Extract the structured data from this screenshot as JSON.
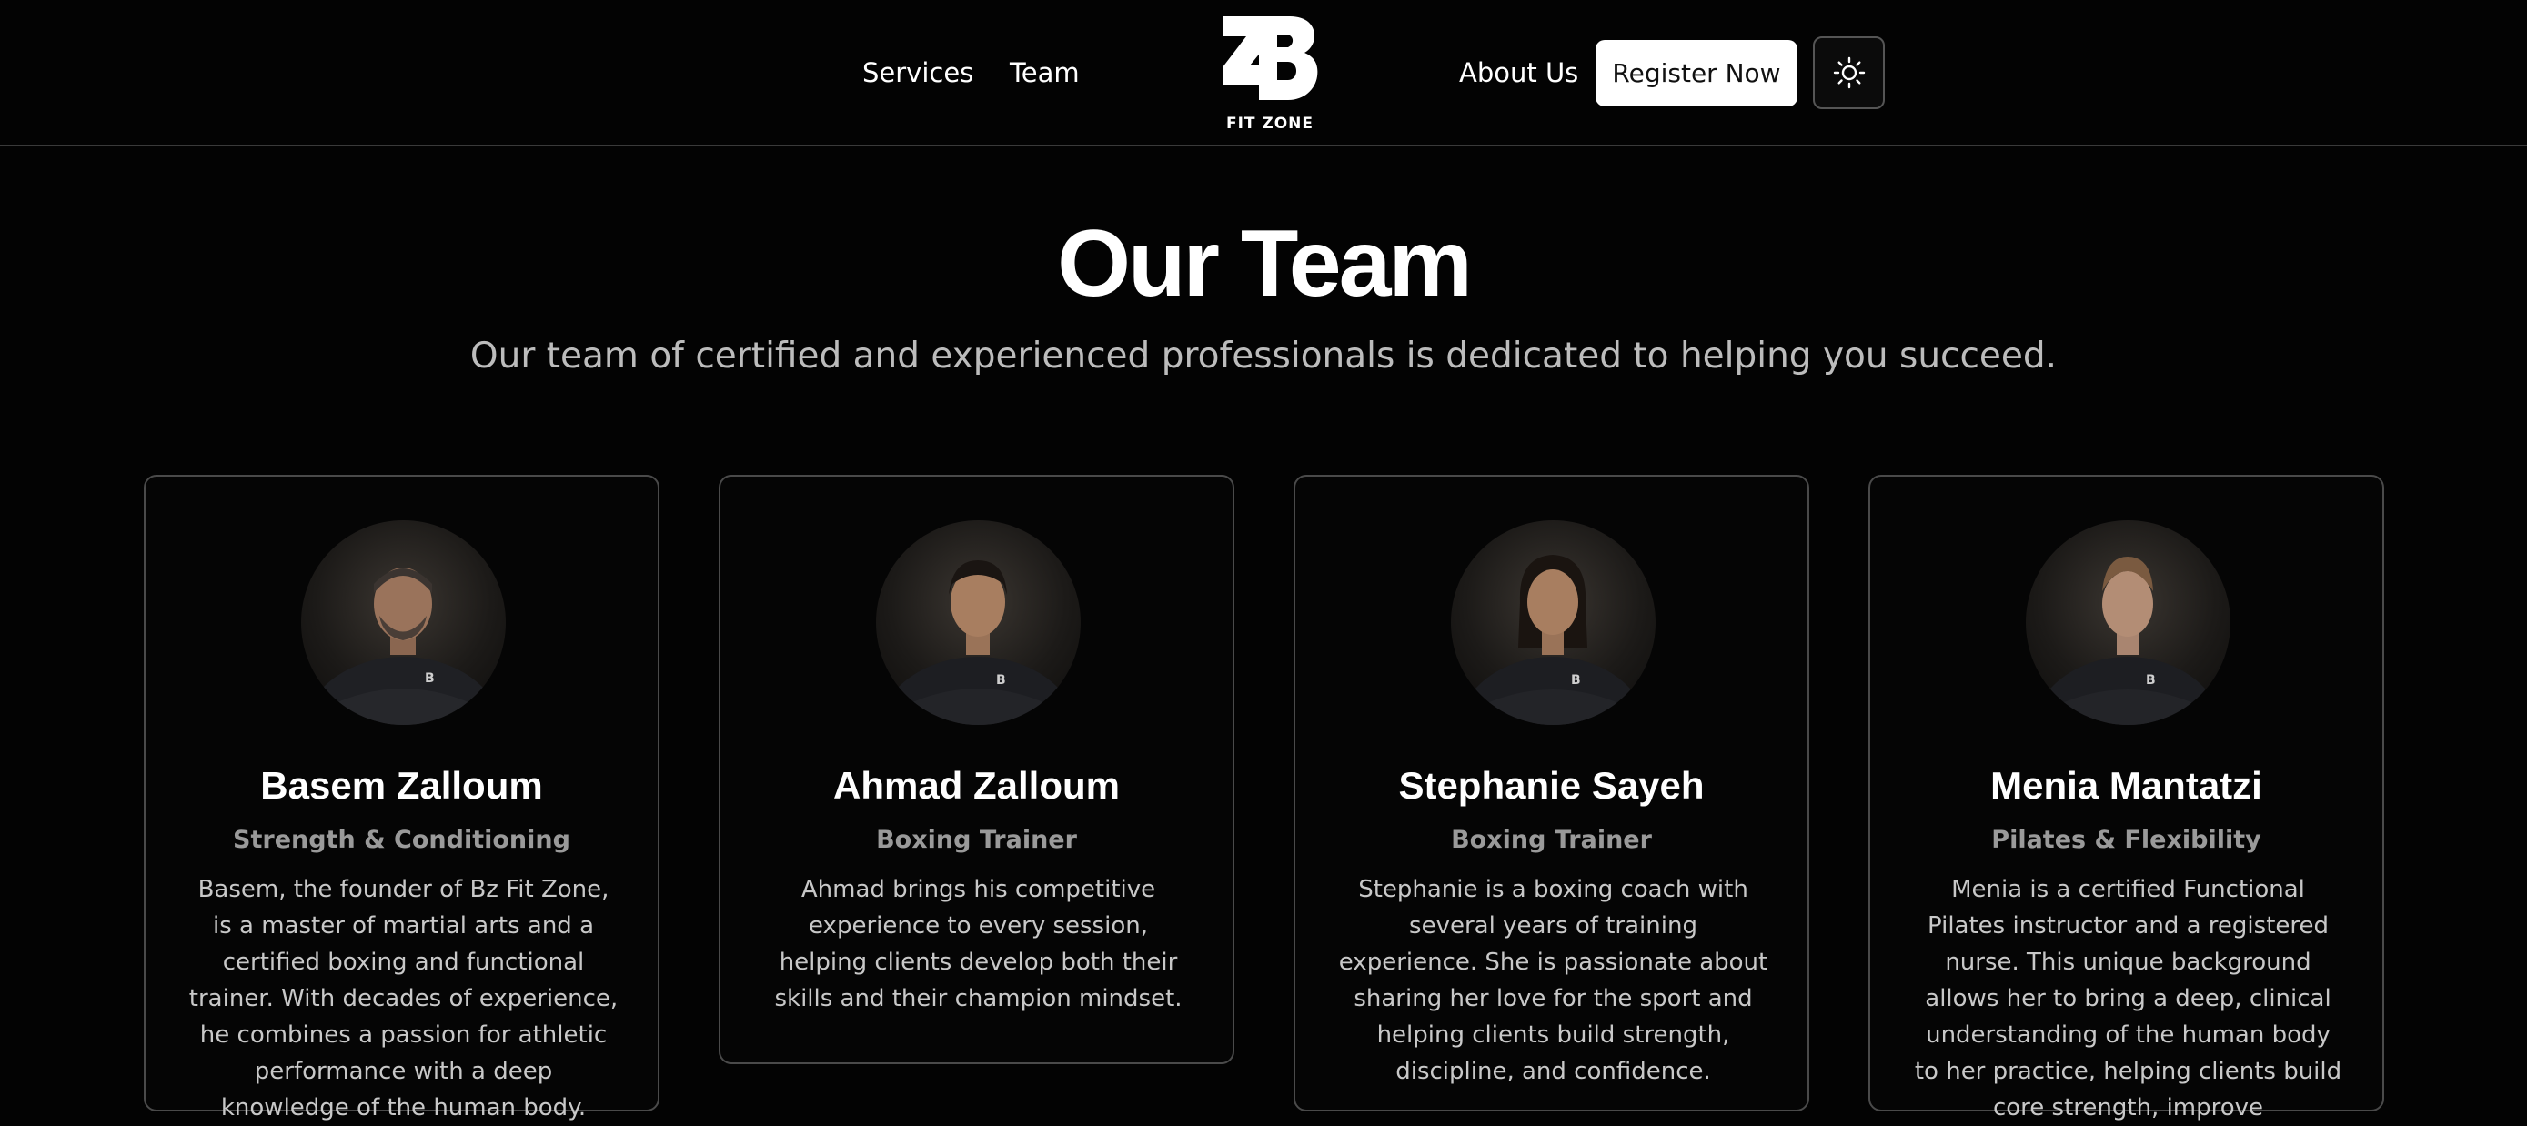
{
  "nav": {
    "services": "Services",
    "team": "Team",
    "about": "About Us",
    "register": "Register Now",
    "logo_text": "FIT ZONE",
    "theme_icon": "sun-icon"
  },
  "hero": {
    "title": "Our Team",
    "subtitle": "Our team of certified and experienced professionals is dedicated to helping you succeed."
  },
  "team": [
    {
      "name": "Basem Zalloum",
      "role": "Strength & Conditioning",
      "bio": "Basem, the founder of Bz Fit Zone, is a master of martial arts and a certified boxing and functional trainer. With decades of experience, he combines a passion for athletic performance with a deep knowledge of the human body."
    },
    {
      "name": "Ahmad Zalloum",
      "role": "Boxing Trainer",
      "bio": "Ahmad brings his competitive experience to every session, helping clients develop both their skills and their champion mindset."
    },
    {
      "name": "Stephanie Sayeh",
      "role": "Boxing Trainer",
      "bio": "Stephanie is a boxing coach with several years of training experience. She is passionate about sharing her love for the sport and helping clients build strength, discipline, and confidence."
    },
    {
      "name": "Menia Mantatzi",
      "role": "Pilates & Flexibility",
      "bio": "Menia is a certified Functional Pilates instructor and a registered nurse. This unique background allows her to bring a deep, clinical understanding of the human body to her practice, helping clients build core strength, improve"
    }
  ]
}
